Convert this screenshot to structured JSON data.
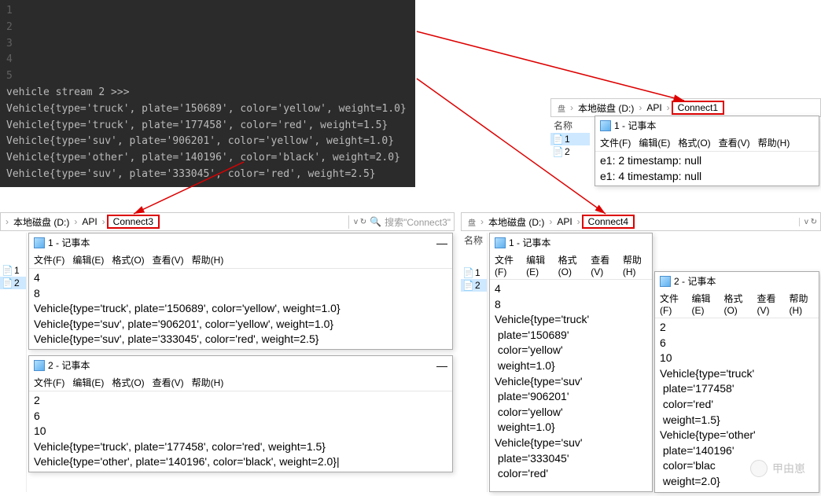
{
  "terminal": {
    "line_numbers": [
      "1",
      "2",
      "3",
      "4",
      "5"
    ],
    "header": "vehicle stream 2 >>>",
    "lines": [
      "Vehicle{type='truck', plate='150689', color='yellow', weight=1.0}",
      "Vehicle{type='truck', plate='177458', color='red', weight=1.5}",
      "Vehicle{type='suv', plate='906201', color='yellow', weight=1.0}",
      "Vehicle{type='other', plate='140196', color='black', weight=2.0}",
      "Vehicle{type='suv', plate='333045', color='red', weight=2.5}"
    ]
  },
  "breadcrumbs": {
    "bl": [
      "本地磁盘 (D:)",
      "API",
      "Connect3"
    ],
    "br": [
      "本地磁盘 (D:)",
      "API",
      "Connect4"
    ],
    "tr": [
      "本地磁盘 (D:)",
      "API",
      "Connect1"
    ],
    "chev_prefix": "盘"
  },
  "search": {
    "label": "搜索",
    "bl_hint": "\"Connect3\""
  },
  "name_col": "名称",
  "files": {
    "f1": "1",
    "f2": "2"
  },
  "notepad_common": {
    "suffix": " - 记事本",
    "menu": {
      "file": "文件(F)",
      "edit": "编辑(E)",
      "format": "格式(O)",
      "view": "查看(V)",
      "help": "帮助(H)"
    }
  },
  "np_tr1": {
    "title": "1",
    "body": "e1: 2 timestamp: null\ne1: 4 timestamp: null"
  },
  "np_bl1": {
    "title": "1",
    "body": "4\n8\nVehicle{type='truck', plate='150689', color='yellow', weight=1.0}\nVehicle{type='suv', plate='906201', color='yellow', weight=1.0}\nVehicle{type='suv', plate='333045', color='red', weight=2.5}"
  },
  "np_bl2": {
    "title": "2",
    "body": "2\n6\n10\nVehicle{type='truck', plate='177458', color='red', weight=1.5}\nVehicle{type='other', plate='140196', color='black', weight=2.0}|"
  },
  "np_br1": {
    "title": "1",
    "body": "4\n8\nVehicle{type='truck'\n plate='150689'\n color='yellow'\n weight=1.0}\nVehicle{type='suv'\n plate='906201'\n color='yellow'\n weight=1.0}\nVehicle{type='suv'\n plate='333045'\n color='red'"
  },
  "np_br2": {
    "title": "2",
    "body": "2\n6\n10\nVehicle{type='truck'\n plate='177458'\n color='red'\n weight=1.5}\nVehicle{type='other'\n plate='140196'\n color='blac\n weight=2.0}"
  },
  "watermark": "甲由崽"
}
